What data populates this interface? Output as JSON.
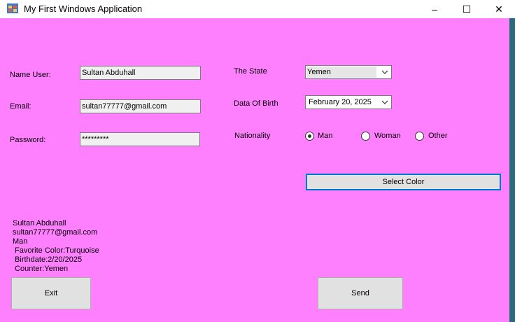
{
  "window": {
    "title": "My First Windows Application",
    "controls": {
      "minimize": "–",
      "maximize": "☐",
      "close": "✕"
    },
    "background_color": "#ff80ff"
  },
  "form": {
    "name": {
      "label": "Name User:",
      "value": "Sultan Abduhall"
    },
    "email": {
      "label": "Email:",
      "value": "sultan77777@gmail.com"
    },
    "password": {
      "label": "Password:",
      "value": "*********"
    },
    "state": {
      "label": "The State",
      "value": "Yemen"
    },
    "birth": {
      "label": "Data Of Birth",
      "value": "February  20, 2025"
    },
    "nationality": {
      "label": "Nationality",
      "options": [
        "Man",
        "Woman",
        "Other"
      ],
      "selected": "Man"
    },
    "select_color_label": "Select Color"
  },
  "output": {
    "lines": [
      "Sultan Abduhall",
      "sultan77777@gmail.com",
      "Man",
      " Favorite Color:Turquoise",
      " Birthdate:2/20/2025",
      " Counter:Yemen"
    ]
  },
  "buttons": {
    "exit": "Exit",
    "send": "Send"
  },
  "icons": {
    "app": "windows-form-icon",
    "dropdown": "chevron-down-icon"
  }
}
